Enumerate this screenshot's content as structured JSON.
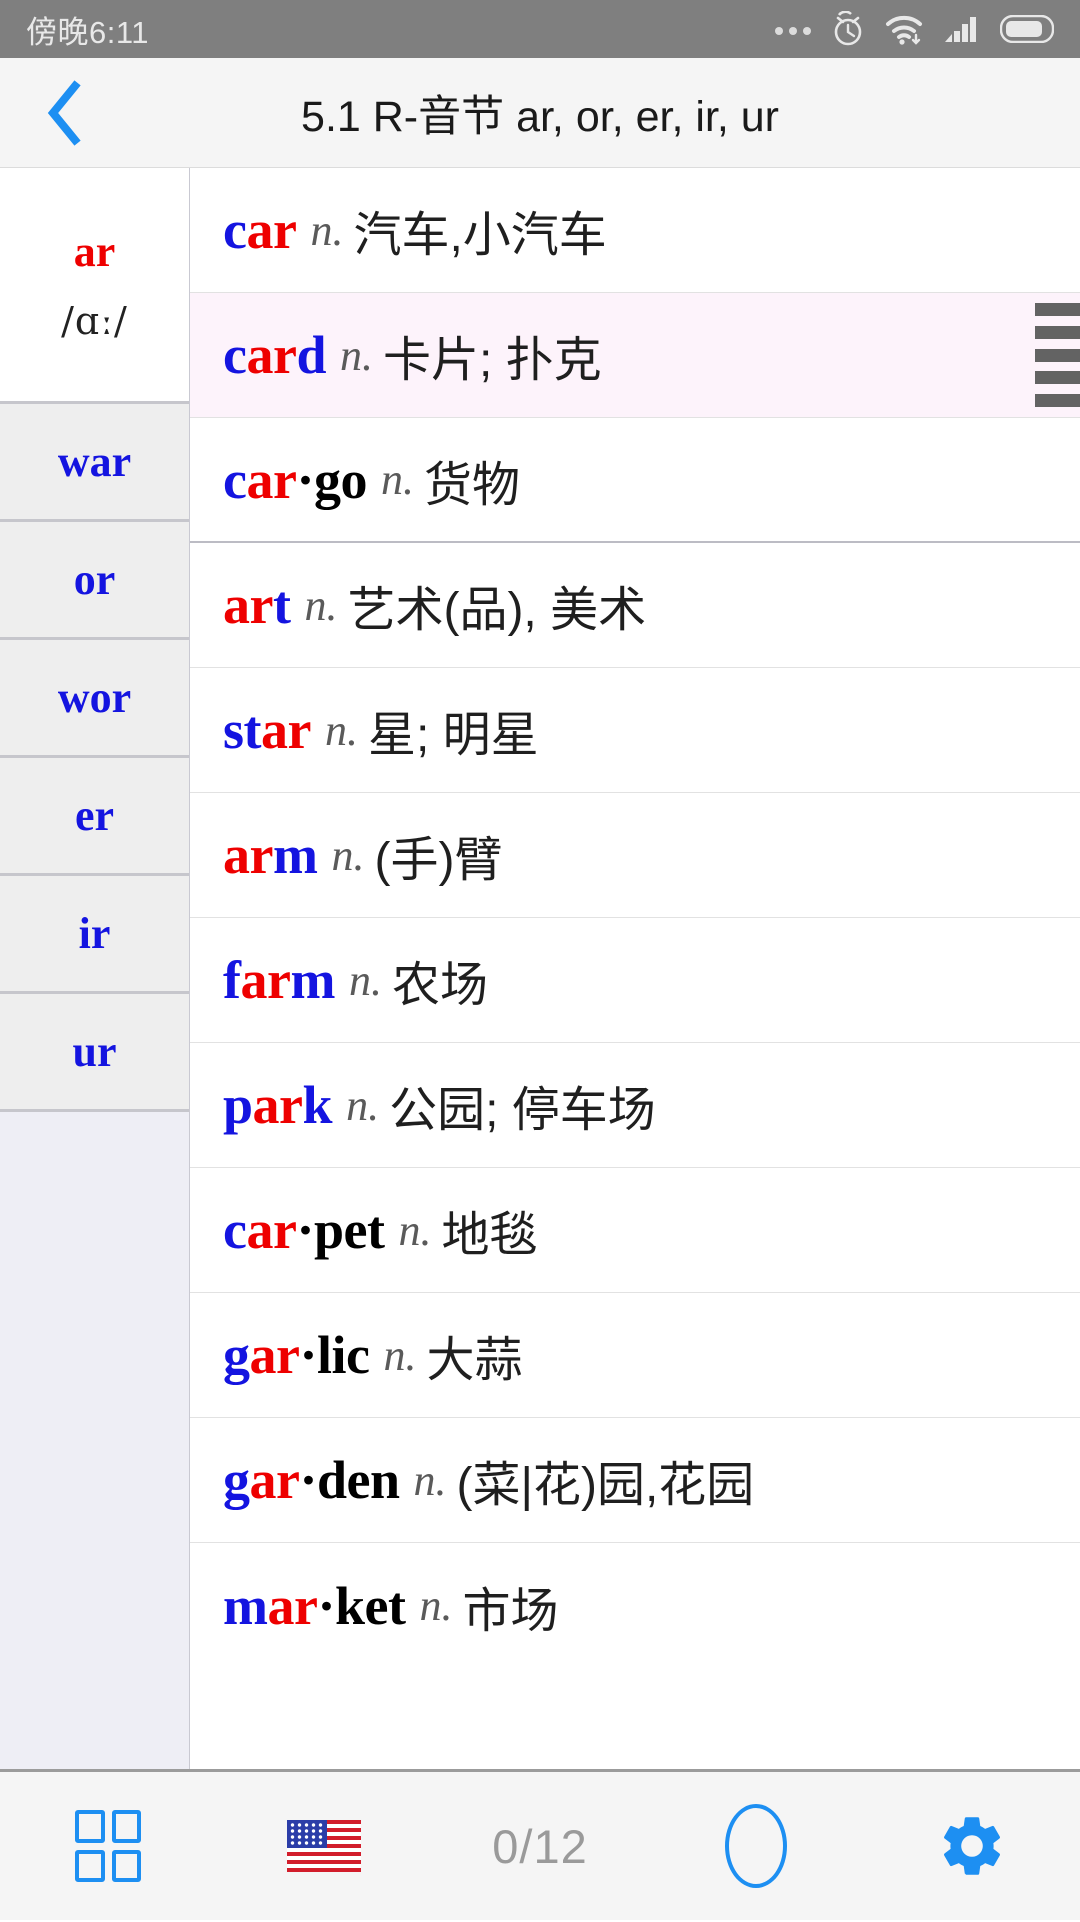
{
  "status_bar": {
    "time": "傍晚6:11",
    "icons": [
      "more-dots-icon",
      "alarm-clock-icon",
      "wifi-icon",
      "signal-bars-icon",
      "battery-icon"
    ],
    "background_color": "#7f7f7f"
  },
  "title_bar": {
    "back_icon": "chevron-left-icon",
    "title": "5.1 R-音节 ar, or, er, ir, ur",
    "accent_color": "#1d8ff2"
  },
  "sidebar": {
    "items": [
      {
        "label": "ar",
        "phonetic": "/ɑː/",
        "active": true
      },
      {
        "label": "war",
        "phonetic": "",
        "active": false
      },
      {
        "label": "or",
        "phonetic": "",
        "active": false
      },
      {
        "label": "wor",
        "phonetic": "",
        "active": false
      },
      {
        "label": "er",
        "phonetic": "",
        "active": false
      },
      {
        "label": "ir",
        "phonetic": "",
        "active": false
      },
      {
        "label": "ur",
        "phonetic": "",
        "active": false
      }
    ],
    "active_color": "#ee0000",
    "inactive_color": "#1414e0"
  },
  "word_list": {
    "rows": [
      {
        "segments": [
          {
            "t": "c",
            "c": "b"
          },
          {
            "t": "ar",
            "c": "r"
          }
        ],
        "word": "car",
        "pos": "n.",
        "meaning": "汽车,小汽车",
        "selected": false,
        "strong_sep": false
      },
      {
        "segments": [
          {
            "t": "c",
            "c": "b"
          },
          {
            "t": "ar",
            "c": "r"
          },
          {
            "t": "d",
            "c": "b"
          }
        ],
        "word": "card",
        "pos": "n.",
        "meaning": "卡片; 扑克",
        "selected": true,
        "strong_sep": false
      },
      {
        "segments": [
          {
            "t": "c",
            "c": "b"
          },
          {
            "t": "ar",
            "c": "r"
          },
          {
            "t": "·go",
            "c": "k"
          }
        ],
        "word": "car·go",
        "pos": "n.",
        "meaning": "货物",
        "selected": false,
        "strong_sep": true
      },
      {
        "segments": [
          {
            "t": "ar",
            "c": "r"
          },
          {
            "t": "t",
            "c": "b"
          }
        ],
        "word": "art",
        "pos": "n.",
        "meaning": "艺术(品), 美术",
        "selected": false,
        "strong_sep": false
      },
      {
        "segments": [
          {
            "t": "st",
            "c": "b"
          },
          {
            "t": "ar",
            "c": "r"
          }
        ],
        "word": "star",
        "pos": "n.",
        "meaning": "星; 明星",
        "selected": false,
        "strong_sep": false
      },
      {
        "segments": [
          {
            "t": "ar",
            "c": "r"
          },
          {
            "t": "m",
            "c": "b"
          }
        ],
        "word": "arm",
        "pos": "n.",
        "meaning": "(手)臂",
        "selected": false,
        "strong_sep": false
      },
      {
        "segments": [
          {
            "t": "f",
            "c": "b"
          },
          {
            "t": "ar",
            "c": "r"
          },
          {
            "t": "m",
            "c": "b"
          }
        ],
        "word": "farm",
        "pos": "n.",
        "meaning": "农场",
        "selected": false,
        "strong_sep": false
      },
      {
        "segments": [
          {
            "t": "p",
            "c": "b"
          },
          {
            "t": "ar",
            "c": "r"
          },
          {
            "t": "k",
            "c": "b"
          }
        ],
        "word": "park",
        "pos": "n.",
        "meaning": "公园; 停车场",
        "selected": false,
        "strong_sep": false
      },
      {
        "segments": [
          {
            "t": "c",
            "c": "b"
          },
          {
            "t": "ar",
            "c": "r"
          },
          {
            "t": "·pet",
            "c": "k"
          }
        ],
        "word": "car·pet",
        "pos": "n.",
        "meaning": "地毯",
        "selected": false,
        "strong_sep": false
      },
      {
        "segments": [
          {
            "t": "g",
            "c": "b"
          },
          {
            "t": "ar",
            "c": "r"
          },
          {
            "t": "·lic",
            "c": "k"
          }
        ],
        "word": "gar·lic",
        "pos": "n.",
        "meaning": "大蒜",
        "selected": false,
        "strong_sep": false
      },
      {
        "segments": [
          {
            "t": "g",
            "c": "b"
          },
          {
            "t": "ar",
            "c": "r"
          },
          {
            "t": "·den",
            "c": "k"
          }
        ],
        "word": "gar·den",
        "pos": "n.",
        "meaning": "(菜|花)园,花园",
        "selected": false,
        "strong_sep": false
      },
      {
        "segments": [
          {
            "t": "m",
            "c": "b"
          },
          {
            "t": "ar",
            "c": "r"
          },
          {
            "t": "·ket",
            "c": "k"
          }
        ],
        "word": "mar·ket",
        "pos": "n.",
        "meaning": "市场",
        "selected": false,
        "strong_sep": false
      }
    ],
    "selected_row_bg": "#fdf3fb",
    "drag_handle_icon": "drag-handle-icon",
    "blue": "#1414e0",
    "red": "#ee0000",
    "black": "#000000"
  },
  "toolbar": {
    "grid_label": "grid-icon",
    "flag_label": "us-flag-icon",
    "counter": "0/12",
    "circle_label": "circle-icon",
    "settings_label": "gear-icon",
    "accent_color": "#1d8ff2",
    "counter_color": "#9a9a9a"
  }
}
